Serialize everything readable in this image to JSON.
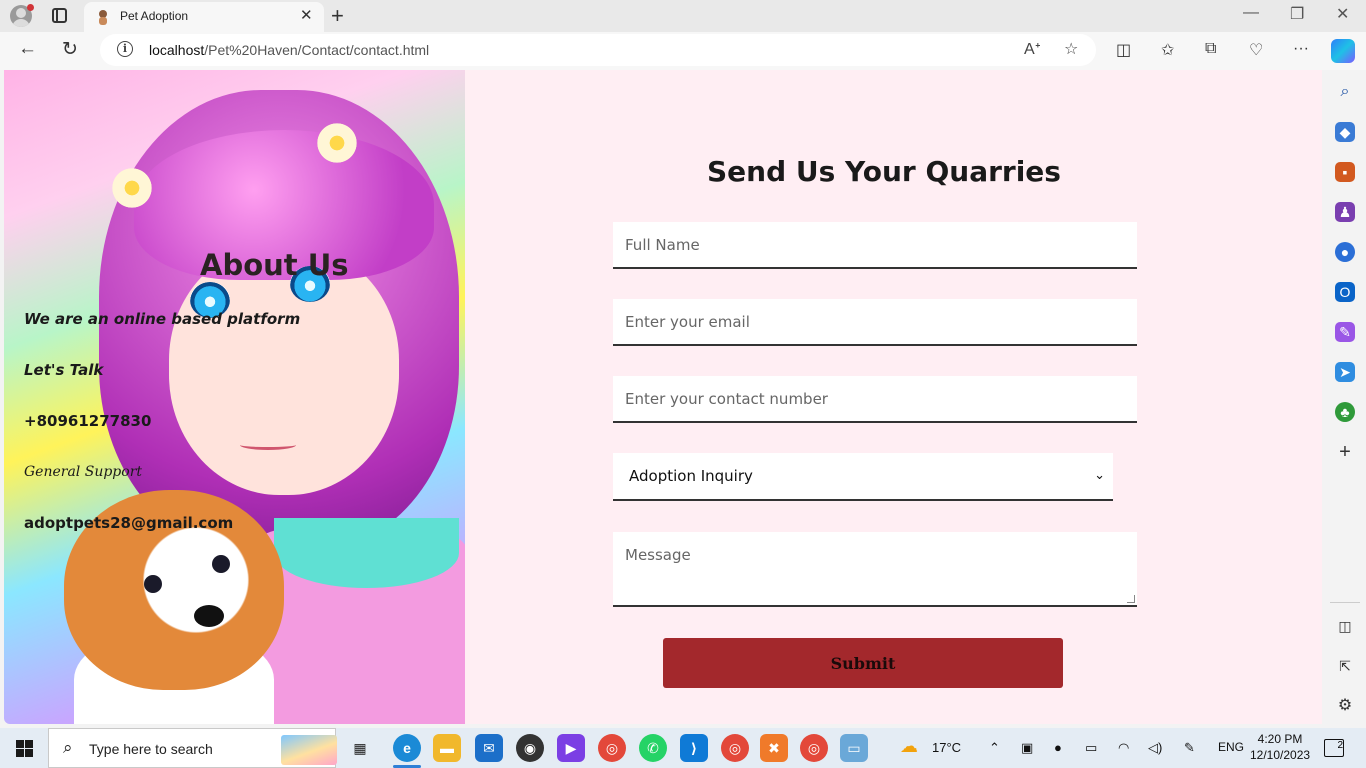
{
  "browser": {
    "tab_title": "Pet Adoption",
    "url_host": "localhost",
    "url_path": "/Pet%20Haven/Contact/contact.html",
    "icons": [
      "profile-icon",
      "tab-actions-icon",
      "back-icon",
      "refresh-icon",
      "info-icon",
      "read-aloud-icon",
      "favorite-star-icon",
      "split-screen-icon",
      "favorites-icon",
      "collections-icon",
      "performance-icon",
      "more-icon",
      "copilot-icon"
    ]
  },
  "about": {
    "title": "About Us",
    "tagline": "We are an online based platform",
    "lets_talk": "Let's Talk",
    "phone": "+80961277830",
    "support_label": "General Support",
    "email": "adoptpets28@gmail.com"
  },
  "form": {
    "heading": "Send Us Your Quarries",
    "name_placeholder": "Full Name",
    "email_placeholder": "Enter your email",
    "contact_placeholder": "Enter your contact number",
    "inquiry_selected": "Adoption Inquiry",
    "message_placeholder": "Message",
    "submit_label": "Submit"
  },
  "taskbar": {
    "search_placeholder": "Type here to search",
    "temperature": "17°C",
    "language": "ENG",
    "time": "4:20 PM",
    "date": "12/10/2023",
    "notification_count": "2"
  },
  "colors": {
    "page_bg": "#ffeef3",
    "submit_bg": "#a3282c",
    "field_border": "#333333"
  }
}
